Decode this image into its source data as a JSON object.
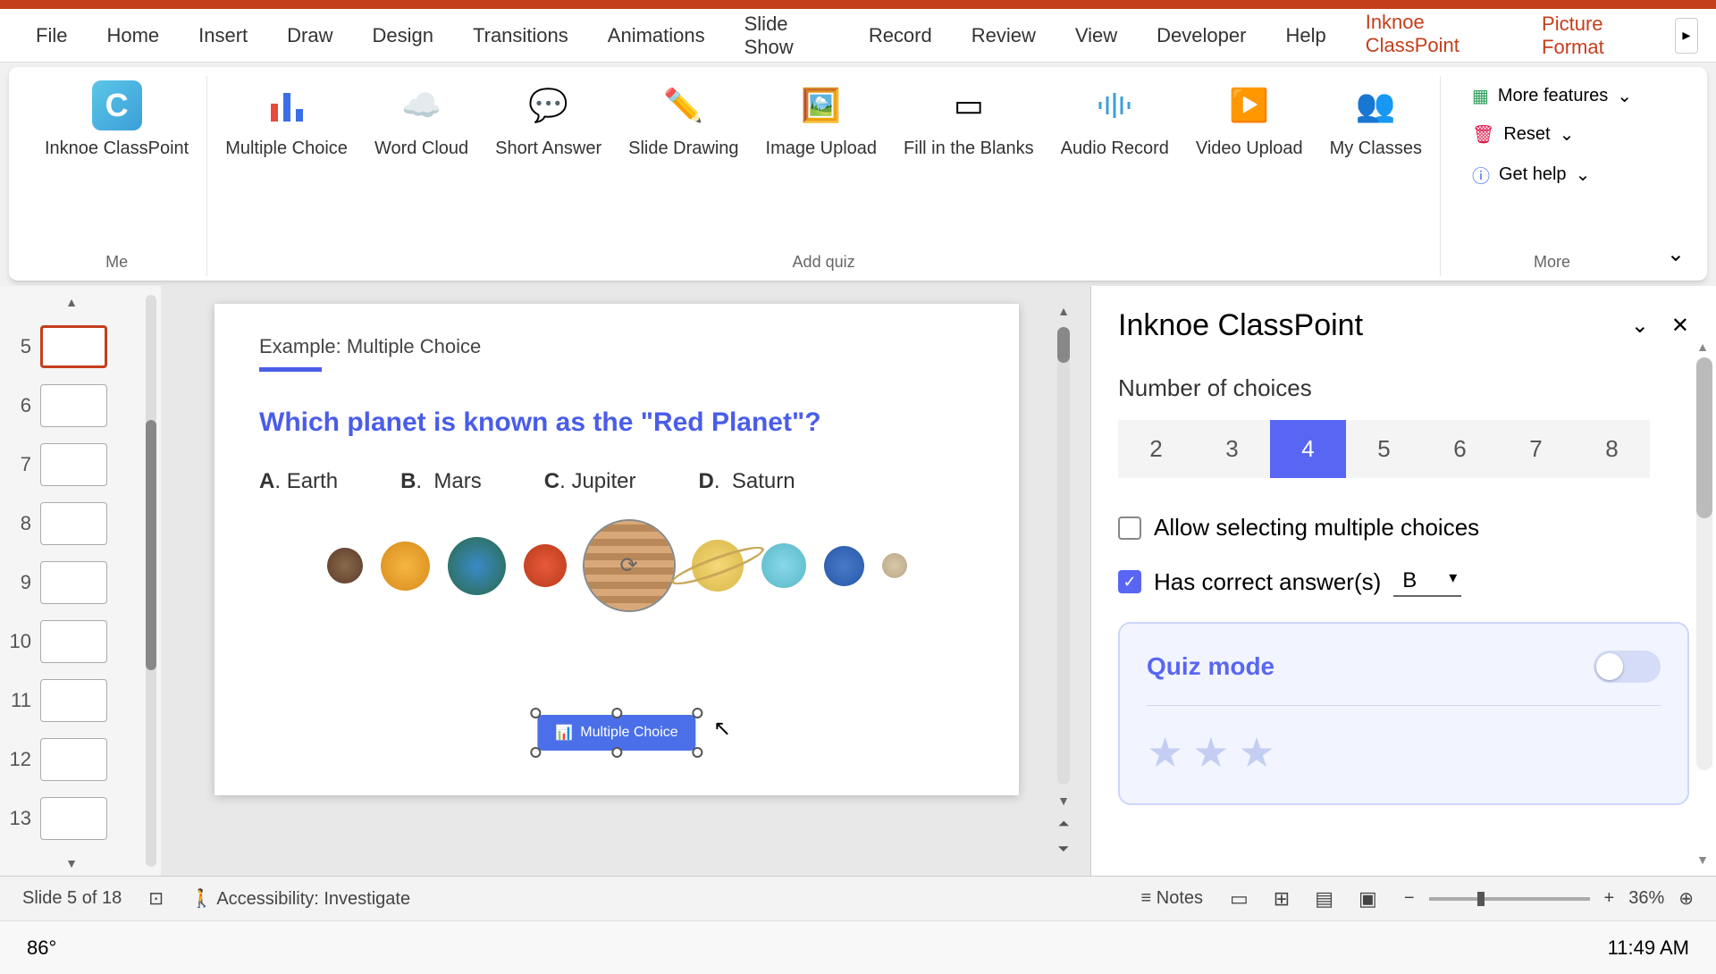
{
  "tabs": [
    "File",
    "Home",
    "Insert",
    "Draw",
    "Design",
    "Transitions",
    "Animations",
    "Slide Show",
    "Record",
    "Review",
    "View",
    "Developer",
    "Help",
    "Inknoe ClassPoint",
    "Picture Format"
  ],
  "active_tab": "Inknoe ClassPoint",
  "ribbon_groups": {
    "me": {
      "title": "Me",
      "item": "Inknoe ClassPoint"
    },
    "addquiz": {
      "title": "Add quiz",
      "items": [
        "Multiple Choice",
        "Word Cloud",
        "Short Answer",
        "Slide Drawing",
        "Image Upload",
        "Fill in the Blanks",
        "Audio Record",
        "Video Upload",
        "My Classes"
      ]
    },
    "more": {
      "title": "More",
      "items": [
        "More features",
        "Reset",
        "Get help"
      ]
    }
  },
  "thumbnails": [
    5,
    6,
    7,
    8,
    9,
    10,
    11,
    12,
    13
  ],
  "active_thumb": 5,
  "slide": {
    "subtitle": "Example: Multiple Choice",
    "question": "Which planet is known as the \"Red Planet\"?",
    "options": [
      {
        "letter": "A",
        "text": "Earth"
      },
      {
        "letter": "B",
        "text": "Mars"
      },
      {
        "letter": "C",
        "text": "Jupiter"
      },
      {
        "letter": "D",
        "text": "Saturn"
      }
    ],
    "button_label": "Multiple Choice"
  },
  "panel": {
    "title": "Inknoe ClassPoint",
    "choices_label": "Number of choices",
    "choice_values": [
      "2",
      "3",
      "4",
      "5",
      "6",
      "7",
      "8"
    ],
    "choice_active": "4",
    "allow_multiple": "Allow selecting multiple choices",
    "has_correct": "Has correct answer(s)",
    "correct_value": "B",
    "quiz_mode": "Quiz mode"
  },
  "statusbar": {
    "slide_info": "Slide 5 of 18",
    "accessibility": "Accessibility: Investigate",
    "notes": "Notes",
    "zoom": "36%"
  },
  "taskbar": {
    "temp": "86°",
    "time": "11:49 AM"
  }
}
